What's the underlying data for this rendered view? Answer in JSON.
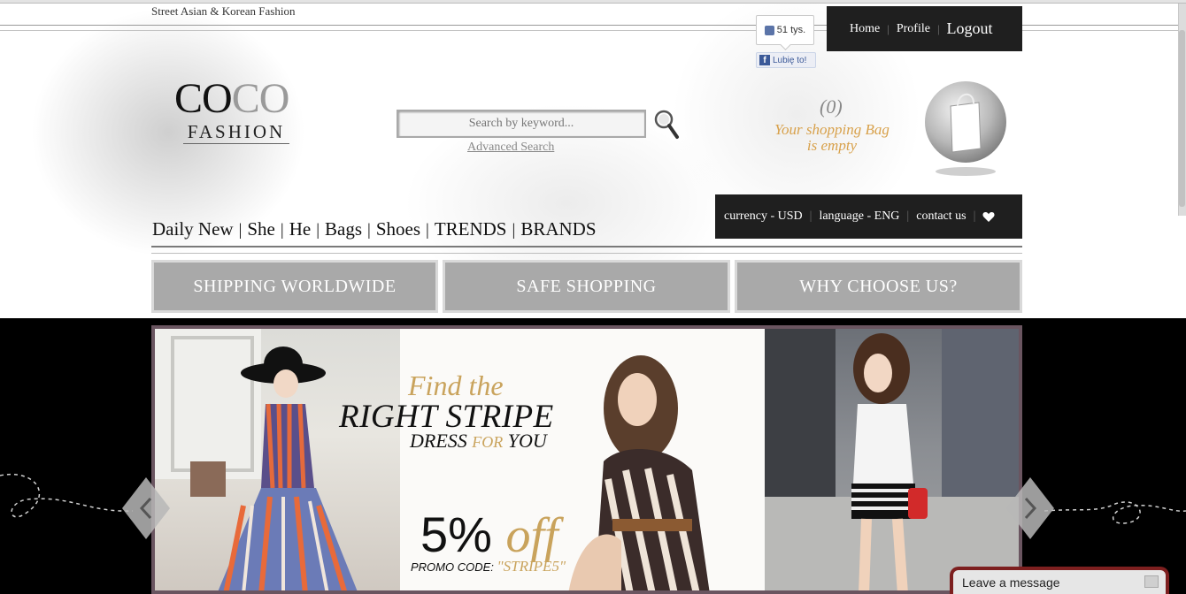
{
  "tagline": "Street Asian & Korean Fashion",
  "like_widget": {
    "count": "51 tys.",
    "button": "Lubię to!"
  },
  "top_nav": {
    "home": "Home",
    "profile": "Profile",
    "logout": "Logout"
  },
  "logo": {
    "coco_dark": "CO",
    "coco_light": "CO",
    "fashion": "FASHION"
  },
  "search": {
    "placeholder": "Search by keyword...",
    "advanced": "Advanced Search"
  },
  "bag": {
    "count": "(0)",
    "line1": "Your shopping Bag",
    "line2": "is empty"
  },
  "main_nav": [
    "Daily New",
    "She",
    "He",
    "Bags",
    "Shoes",
    "TRENDS",
    "BRANDS"
  ],
  "util": {
    "currency": "currency - USD",
    "language": "language - ENG",
    "contact": "contact us"
  },
  "features": [
    "SHIPPING WORLDWIDE",
    "SAFE SHOPPING",
    "WHY CHOOSE US?"
  ],
  "banner": {
    "find_the": "Find the",
    "right_stripe": "RIGHT STRIPE",
    "dress": "DRESS",
    "for": "FOR",
    "you": "YOU",
    "percent": "5%",
    "off": "off",
    "promo_label": "PROMO CODE:",
    "promo_code": "\"STRIPE5\""
  },
  "chat": {
    "label": "Leave a message"
  },
  "colors": {
    "gold": "#c9a35c",
    "dark_bar": "#1f1f1f",
    "feature_gray": "#a9a9a9",
    "chat_border": "#7d1f1f"
  }
}
